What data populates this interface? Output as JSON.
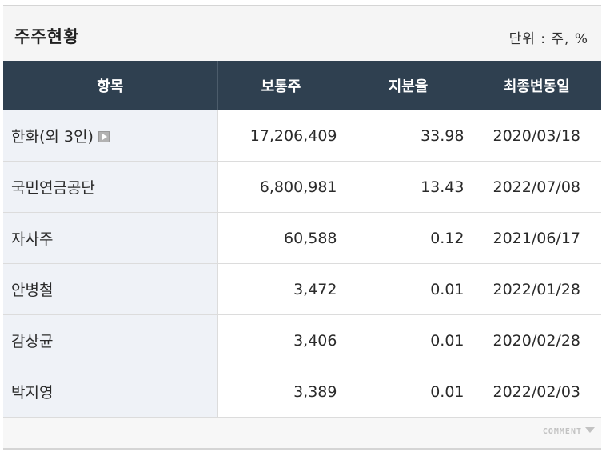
{
  "header": {
    "title": "주주현황",
    "unit": "단위 : 주, %"
  },
  "table": {
    "columns": [
      "항목",
      "보통주",
      "지분율",
      "최종변동일"
    ],
    "rows": [
      {
        "name": "한화(외 3인)",
        "shares": "17,206,409",
        "ratio": "33.98",
        "date": "2020/03/18",
        "has_detail": true
      },
      {
        "name": "국민연금공단",
        "shares": "6,800,981",
        "ratio": "13.43",
        "date": "2022/07/08"
      },
      {
        "name": "자사주",
        "shares": "60,588",
        "ratio": "0.12",
        "date": "2021/06/17"
      },
      {
        "name": "안병철",
        "shares": "3,472",
        "ratio": "0.01",
        "date": "2022/01/28"
      },
      {
        "name": "감상균",
        "shares": "3,406",
        "ratio": "0.01",
        "date": "2020/02/28"
      },
      {
        "name": "박지영",
        "shares": "3,389",
        "ratio": "0.01",
        "date": "2022/02/03"
      }
    ]
  },
  "footer": {
    "comment_label": "COMMENT"
  },
  "icons": {
    "detail": "play-arrow-icon",
    "comment_toggle": "triangle-down-icon"
  },
  "colors": {
    "header_bg": "#2f4050",
    "first_col_bg": "#eff2f7",
    "title_bar_bg": "#f5f5f5"
  }
}
